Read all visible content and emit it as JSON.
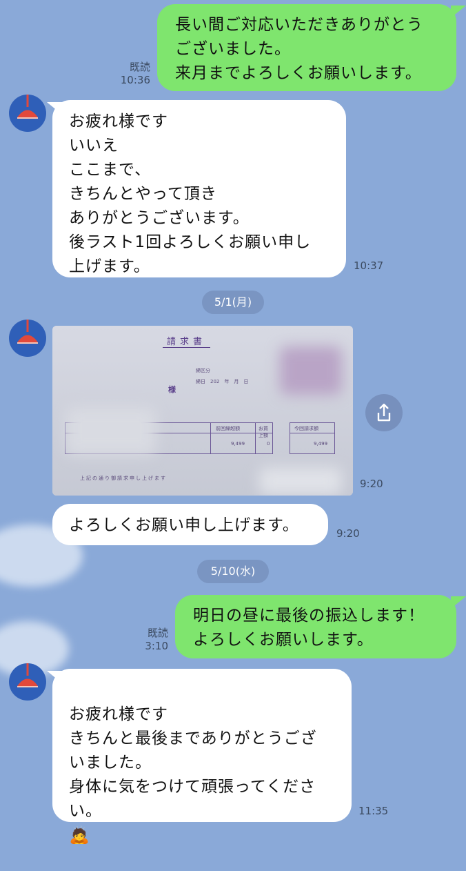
{
  "messages": [
    {
      "side": "sent",
      "text": "長い間ご対応いただきありがとう\nございました。\n来月までよろしくお願いします。",
      "read": "既読",
      "time": "10:36"
    },
    {
      "side": "recv",
      "text": "お疲れ様です\nいいえ\nここまで、\nきちんとやって頂き\nありがとうございます。\n後ラスト1回よろしくお願い申し\n上げます。",
      "time": "10:37"
    },
    {
      "side": "recv",
      "text": "よろしくお願い申し上げます。",
      "time": "9:20"
    },
    {
      "side": "sent",
      "text": "明日の昼に最後の振込します！\nよろしくお願いします。",
      "read": "既読",
      "time": "3:10"
    },
    {
      "side": "recv",
      "text": "お疲れ様です\nきちんと最後までありがとうござ\nいました。\n身体に気をつけて頑張ってくださ\nい。",
      "emoji": "🙇",
      "time": "11:35"
    }
  ],
  "dates": [
    "5/1(月)",
    "5/10(水)"
  ],
  "image_message": {
    "time": "9:20",
    "invoice": {
      "title": "請求書",
      "shimebi_label": "締区分",
      "date_label": "締日　202　年　月　日",
      "honorific": "様",
      "col_prev": "前回繰越額",
      "col_buy": "お買上額",
      "col_total": "今回請求額",
      "val_prev": "9,499",
      "val_buy": "0",
      "val_total": "9,499",
      "footer": "上記の通り御請求申し上げます"
    }
  },
  "colors": {
    "background": "#8aa9d8",
    "sent_bubble": "#7fe56e",
    "recv_bubble": "#ffffff",
    "avatar_bg": "#2f5fb8",
    "lamp": "#e2493b"
  },
  "icons": {
    "avatar": "red-pendant-lamp-icon",
    "share": "share-icon"
  }
}
